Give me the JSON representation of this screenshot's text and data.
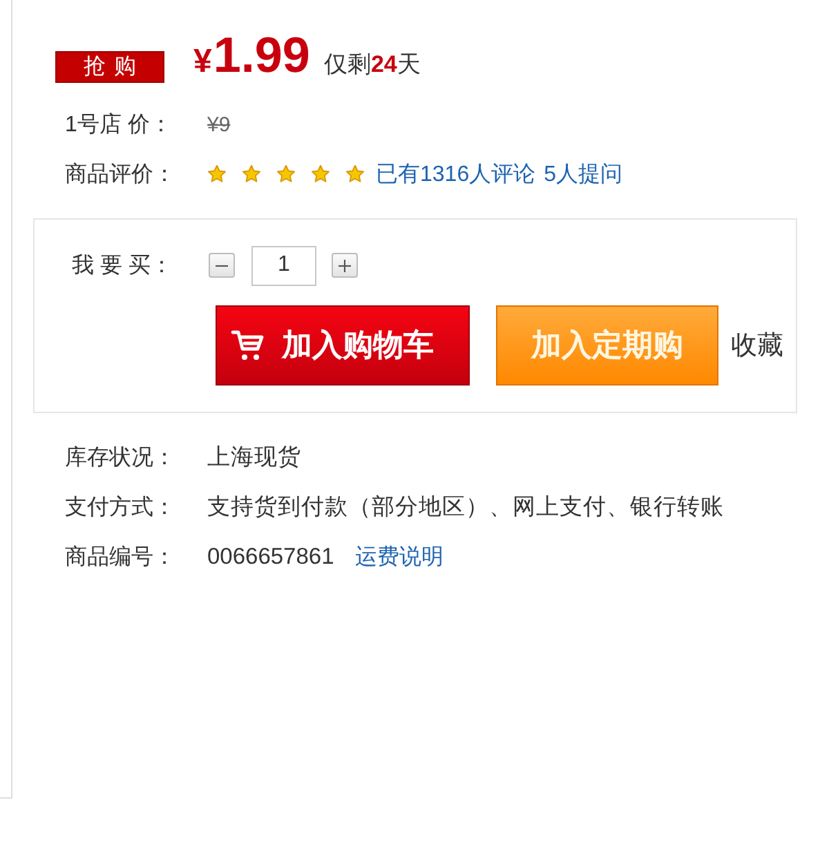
{
  "promo": {
    "badge": "抢购",
    "currency": "¥",
    "price": "1.99",
    "countdown": "仅剩**24**天"
  },
  "list_price": {
    "label": "1号店 价：",
    "value": "¥9"
  },
  "rating": {
    "label": "商品评价：",
    "stars": 5,
    "reviews": "已有1316人评论",
    "questions": "5人提问"
  },
  "purchase": {
    "quantity_label": "我 要 买：",
    "quantity": "1",
    "add_to_cart": "加入购物车",
    "subscribe": "加入定期购",
    "favorite": "收藏"
  },
  "details": [
    {
      "label": "库存状况：",
      "value": "上海现货"
    },
    {
      "label": "支付方式：",
      "value": "支持货到付款（部分地区）、网上支付、银行转账"
    },
    {
      "label": "商品编号：",
      "value": "0066657861",
      "link": "运费说明"
    }
  ]
}
